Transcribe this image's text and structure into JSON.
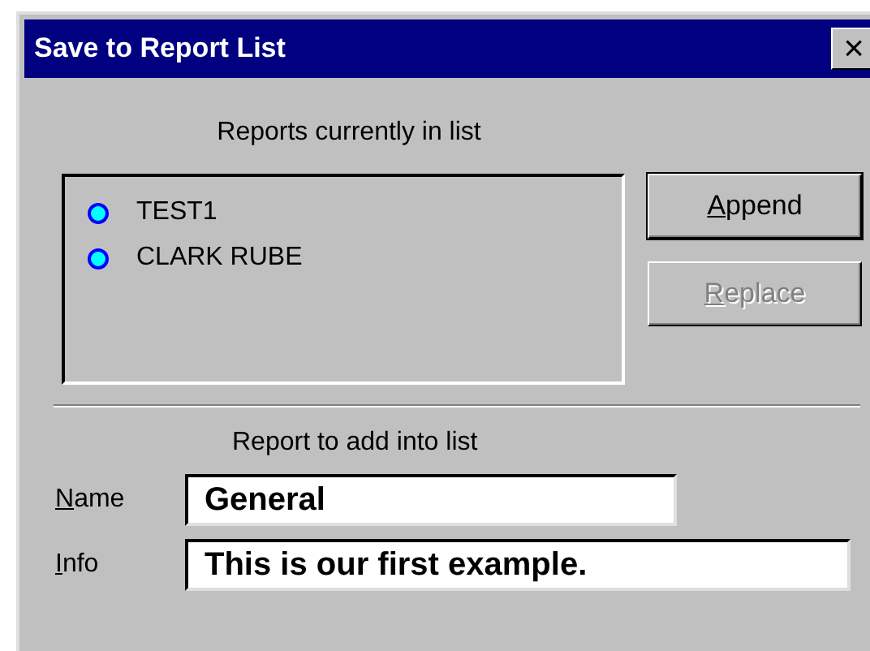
{
  "window": {
    "title": "Save to Report List",
    "close_symbol": "×"
  },
  "reports_label": "Reports currently in list",
  "reports": [
    {
      "name": "TEST1"
    },
    {
      "name": "CLARK RUBE"
    }
  ],
  "buttons": [
    {
      "label": "Append",
      "disabled": false
    },
    {
      "label": "Replace",
      "disabled": true
    }
  ],
  "add_label": "Report to add into list",
  "fields": [
    {
      "label": "Name",
      "value": "General"
    },
    {
      "label": "Info",
      "value": "This is our first example."
    }
  ]
}
